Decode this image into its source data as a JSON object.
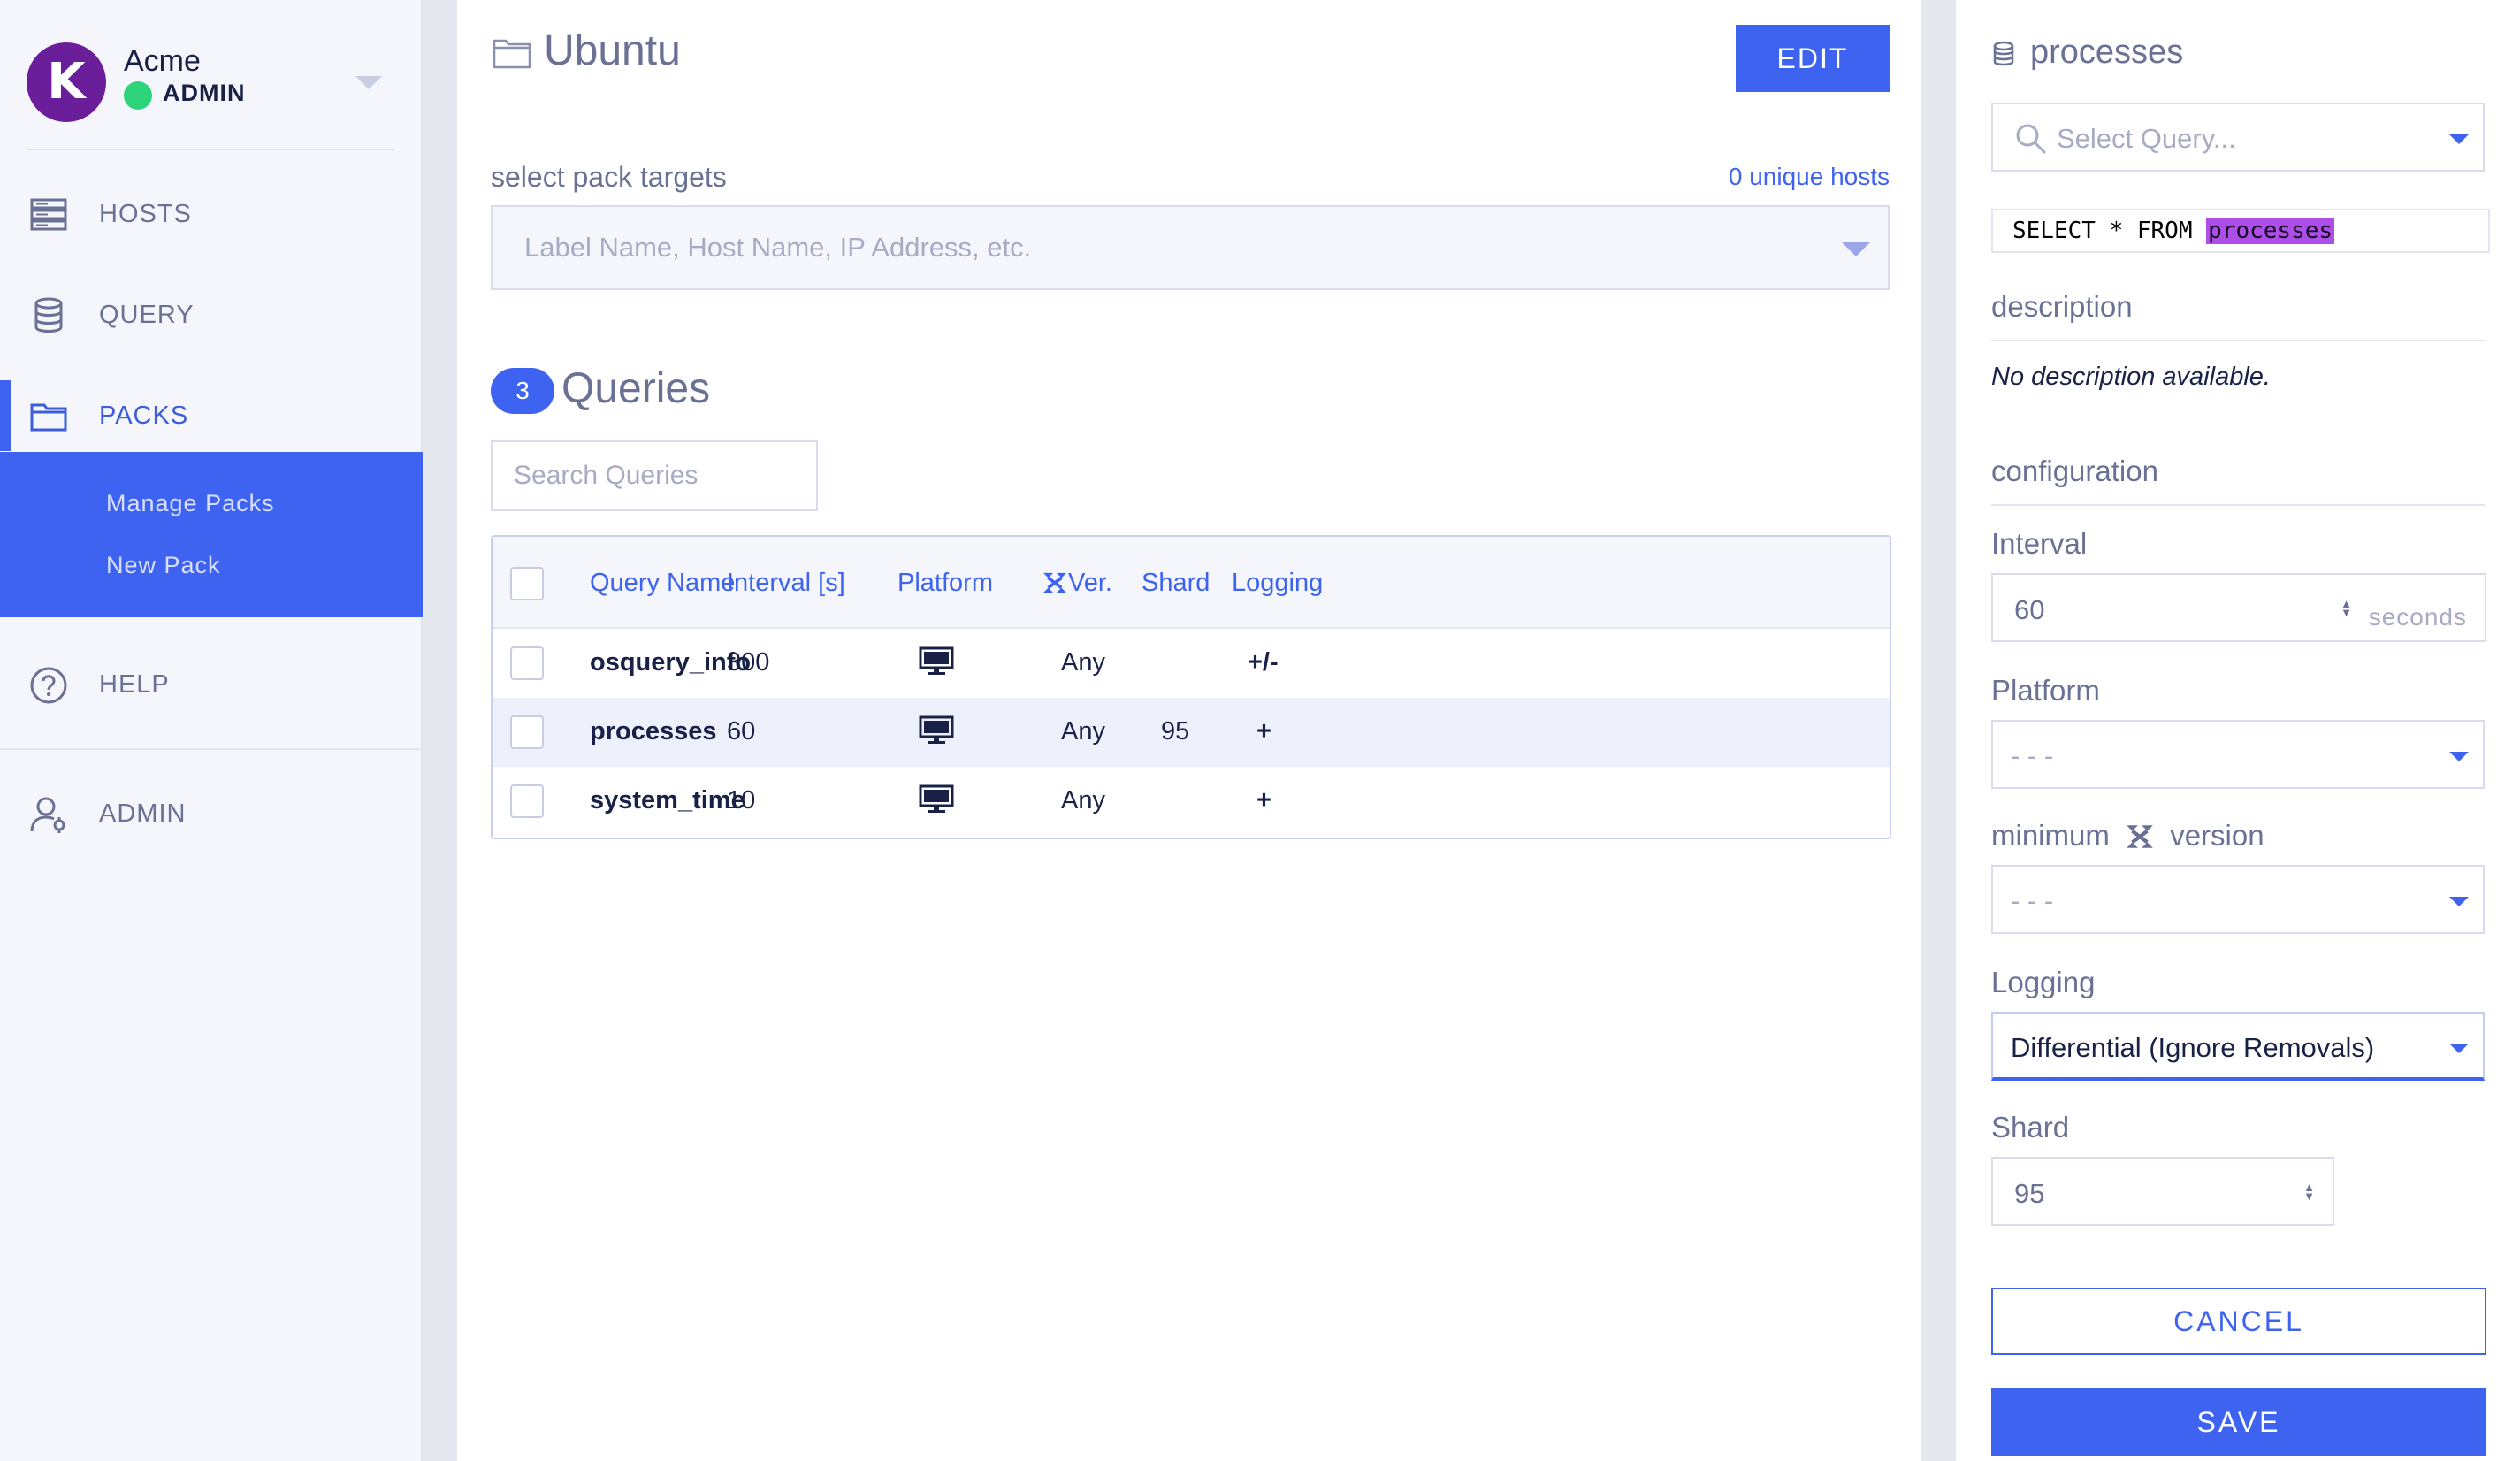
{
  "brand": {
    "logo_letter": "K",
    "org_name": "Acme",
    "role": "ADMIN",
    "status_color": "#2ed47a",
    "logo_color": "#6b1e9a"
  },
  "nav": {
    "hosts": "HOSTS",
    "query": "QUERY",
    "packs": "PACKS",
    "manage_packs": "Manage Packs",
    "new_pack": "New Pack",
    "help": "HELP",
    "admin": "ADMIN"
  },
  "pack": {
    "title": "Ubuntu",
    "edit_label": "EDIT",
    "targets_label": "select pack targets",
    "unique_hosts": "0 unique hosts",
    "targets_placeholder": "Label Name, Host Name, IP Address, etc."
  },
  "queries": {
    "count": "3",
    "title": "Queries",
    "search_placeholder": "Search Queries",
    "columns": [
      "Query Name",
      "Interval [s]",
      "Platform",
      "Ver.",
      "Shard",
      "Logging"
    ],
    "rows": [
      {
        "name": "osquery_info",
        "interval": "300",
        "platform": "monitor-icon",
        "version": "Any",
        "shard": "",
        "logging": "+/-",
        "selected": false
      },
      {
        "name": "processes",
        "interval": "60",
        "platform": "monitor-icon",
        "version": "Any",
        "shard": "95",
        "logging": "+",
        "selected": true
      },
      {
        "name": "system_time",
        "interval": "10",
        "platform": "monitor-icon",
        "version": "Any",
        "shard": "",
        "logging": "+",
        "selected": false
      }
    ]
  },
  "editor": {
    "title": "processes",
    "select_placeholder": "Select Query...",
    "sql_prefix": "SELECT * FROM ",
    "sql_table": "processes",
    "description_label": "description",
    "description_text": "No description available.",
    "configuration_label": "configuration",
    "interval_label": "Interval",
    "interval_value": "60",
    "interval_unit": "seconds",
    "platform_label": "Platform",
    "platform_value": "- - -",
    "min_version_label_a": "minimum",
    "min_version_label_b": "version",
    "min_version_value": "- - -",
    "logging_label": "Logging",
    "logging_value": "Differential (Ignore Removals)",
    "shard_label": "Shard",
    "shard_value": "95",
    "cancel_label": "CANCEL",
    "save_label": "SAVE"
  },
  "colors": {
    "accent": "#3e63f0",
    "text_dark": "#192147",
    "text_muted": "#6b7194",
    "sql_highlight": "#ad4ee8"
  }
}
